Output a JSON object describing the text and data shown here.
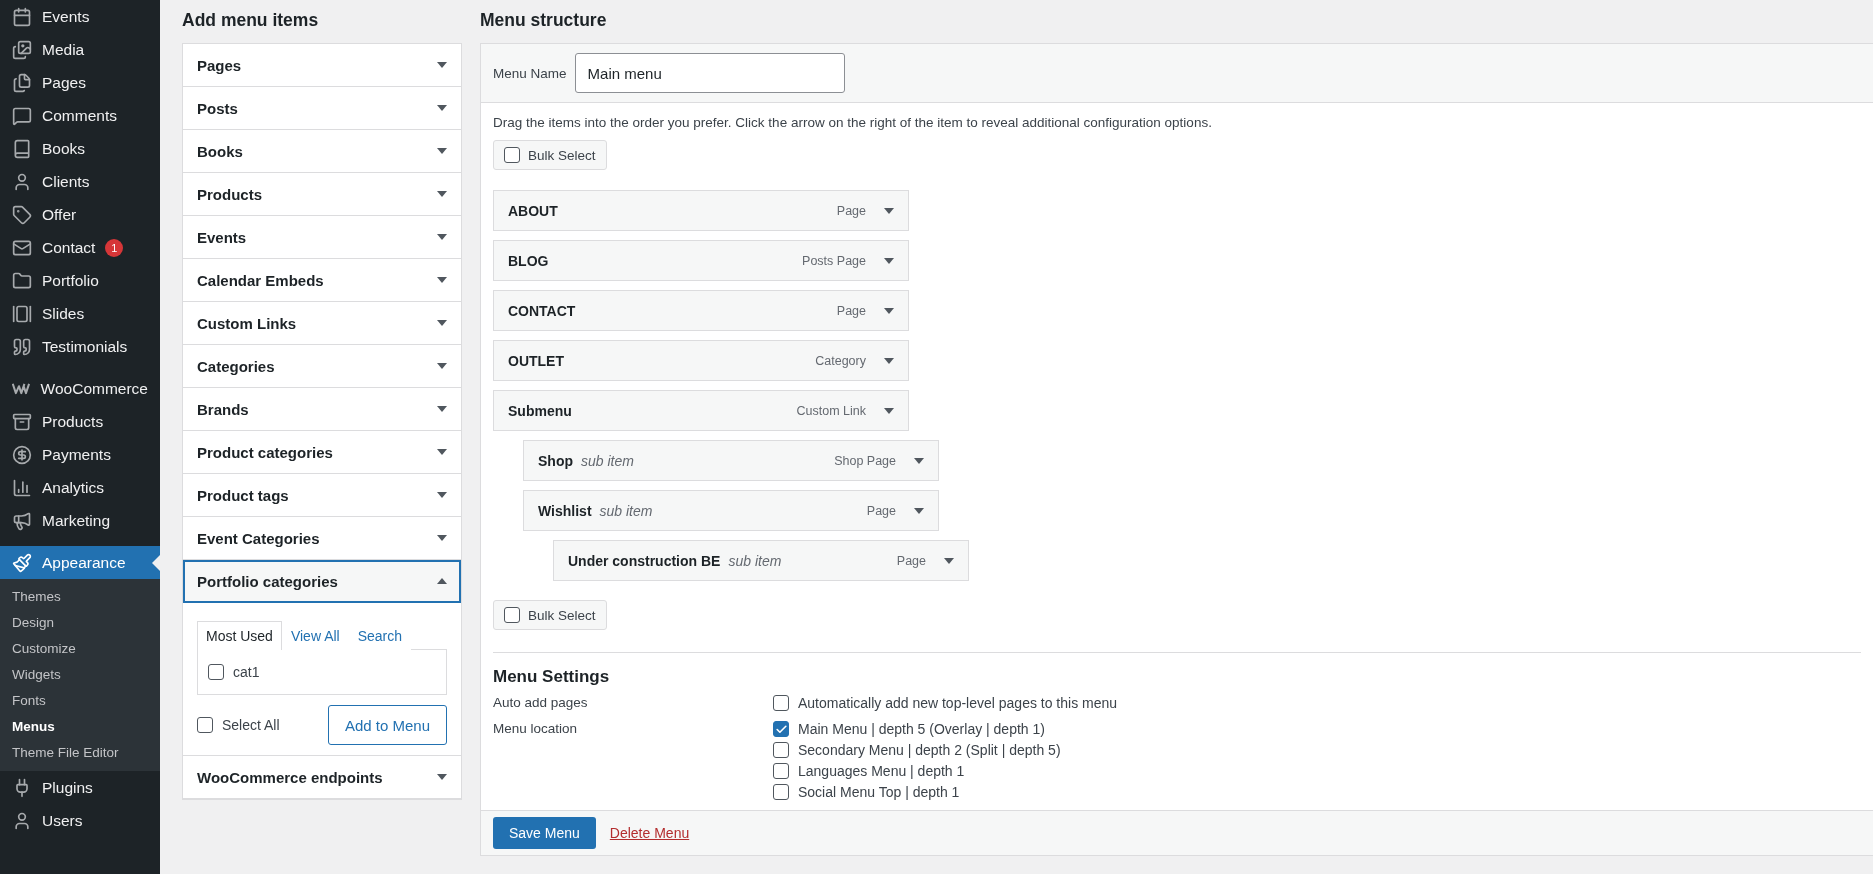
{
  "sidebar": {
    "groups": [
      {
        "items": [
          {
            "label": "Events",
            "selected": false
          },
          {
            "label": "Media",
            "selected": false
          },
          {
            "label": "Pages",
            "selected": false
          },
          {
            "label": "Comments",
            "selected": false
          },
          {
            "label": "Books",
            "selected": false
          },
          {
            "label": "Clients",
            "selected": false
          },
          {
            "label": "Offer",
            "selected": false
          },
          {
            "label": "Contact",
            "selected": false,
            "badge": "1"
          },
          {
            "label": "Portfolio",
            "selected": false
          },
          {
            "label": "Slides",
            "selected": false
          },
          {
            "label": "Testimonials",
            "selected": false
          }
        ]
      },
      {
        "items": [
          {
            "label": "WooCommerce",
            "selected": false
          },
          {
            "label": "Products",
            "selected": false
          },
          {
            "label": "Payments",
            "selected": false
          },
          {
            "label": "Analytics",
            "selected": false
          },
          {
            "label": "Marketing",
            "selected": false
          }
        ]
      },
      {
        "items": [
          {
            "label": "Appearance",
            "selected": true,
            "children": [
              {
                "label": "Themes",
                "selected": false
              },
              {
                "label": "Design",
                "selected": false
              },
              {
                "label": "Customize",
                "selected": false
              },
              {
                "label": "Widgets",
                "selected": false
              },
              {
                "label": "Fonts",
                "selected": false
              },
              {
                "label": "Menus",
                "selected": true
              },
              {
                "label": "Theme File Editor",
                "selected": false
              }
            ]
          },
          {
            "label": "Plugins",
            "selected": false
          },
          {
            "label": "Users",
            "selected": false
          }
        ]
      }
    ]
  },
  "add_items": {
    "title": "Add menu items",
    "panels": [
      {
        "label": "Pages",
        "expanded": false
      },
      {
        "label": "Posts",
        "expanded": false
      },
      {
        "label": "Books",
        "expanded": false
      },
      {
        "label": "Products",
        "expanded": false
      },
      {
        "label": "Events",
        "expanded": false
      },
      {
        "label": "Calendar Embeds",
        "expanded": false
      },
      {
        "label": "Custom Links",
        "expanded": false
      },
      {
        "label": "Categories",
        "expanded": false
      },
      {
        "label": "Brands",
        "expanded": false
      },
      {
        "label": "Product categories",
        "expanded": false
      },
      {
        "label": "Product tags",
        "expanded": false
      },
      {
        "label": "Event Categories",
        "expanded": false
      },
      {
        "label": "Portfolio categories",
        "expanded": true,
        "tabs": [
          {
            "label": "Most Used",
            "selected": true
          },
          {
            "label": "View All",
            "selected": false
          },
          {
            "label": "Search",
            "selected": false
          }
        ],
        "checklist": [
          {
            "label": "cat1",
            "checked": false
          }
        ],
        "select_all": {
          "label": "Select All",
          "checked": false
        },
        "add_button": "Add to Menu"
      },
      {
        "label": "WooCommerce endpoints",
        "expanded": false
      }
    ]
  },
  "menu": {
    "title": "Menu structure",
    "name_label": "Menu Name",
    "name_value": "Main menu",
    "instructions": "Drag the items into the order you prefer. Click the arrow on the right of the item to reveal additional configuration options.",
    "bulk_top": {
      "label": "Bulk Select",
      "checked": false
    },
    "items": [
      {
        "title": "ABOUT",
        "type": "Page"
      },
      {
        "title": "BLOG",
        "type": "Posts Page"
      },
      {
        "title": "CONTACT",
        "type": "Page"
      },
      {
        "title": "OUTLET",
        "type": "Category"
      },
      {
        "title": "Submenu",
        "type": "Custom Link",
        "children": [
          {
            "title": "Shop",
            "note": "sub item",
            "type": "Shop Page"
          },
          {
            "title": "Wishlist",
            "note": "sub item",
            "type": "Page",
            "children": [
              {
                "title": "Under construction BE",
                "note": "sub item",
                "type": "Page"
              }
            ]
          }
        ]
      }
    ],
    "bulk_bottom": {
      "label": "Bulk Select",
      "checked": false
    },
    "settings": {
      "title": "Menu Settings",
      "rows": [
        {
          "label": "Auto add pages",
          "options": [
            {
              "label": "Automatically add new top-level pages to this menu",
              "checked": false
            }
          ]
        },
        {
          "label": "Menu location",
          "options": [
            {
              "label": "Main Menu | depth 5 (Overlay | depth 1)",
              "checked": true
            },
            {
              "label": "Secondary Menu | depth 2 (Split | depth 5)",
              "checked": false
            },
            {
              "label": "Languages Menu | depth 1",
              "checked": false
            },
            {
              "label": "Social Menu Top | depth 1",
              "checked": false
            }
          ]
        }
      ]
    },
    "save_button": "Save Menu",
    "delete_link": "Delete Menu"
  }
}
